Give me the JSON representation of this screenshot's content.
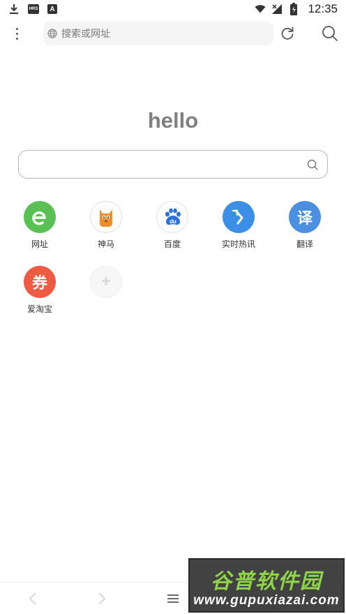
{
  "status_bar": {
    "time": "12:35",
    "left_icons": [
      "download-icon",
      "hd-badge-icon",
      "a-badge-icon"
    ],
    "hd_badge": "HRS",
    "a_badge": "A",
    "right_icons": [
      "wifi-icon",
      "signal-icon",
      "battery-icon"
    ]
  },
  "address_bar": {
    "placeholder": "搜索或网址"
  },
  "logo": {
    "text": "hello"
  },
  "main_search": {
    "placeholder": ""
  },
  "shortcuts": [
    {
      "label": "网址",
      "icon": "ie-e-icon",
      "color": "#59c153"
    },
    {
      "label": "神马",
      "icon": "alpaca-icon",
      "color": "#ffffff"
    },
    {
      "label": "百度",
      "icon": "baidu-paw-icon",
      "color": "#ffffff"
    },
    {
      "label": "实时热讯",
      "icon": "arrow-cursor-icon",
      "color": "#3b8fe6"
    },
    {
      "label": "翻译",
      "icon": "translate-icon",
      "glyph": "译",
      "color": "#4a8fe0"
    },
    {
      "label": "爱淘宝",
      "icon": "coupon-icon",
      "glyph": "券",
      "color": "#ef5a43"
    },
    {
      "label": "",
      "icon": "add-icon",
      "glyph": "+",
      "color": "#f7f7f7"
    }
  ],
  "baidu_text": "du",
  "watermark": {
    "title": "谷普软件园",
    "url": "www.gupuxiazai.com"
  }
}
